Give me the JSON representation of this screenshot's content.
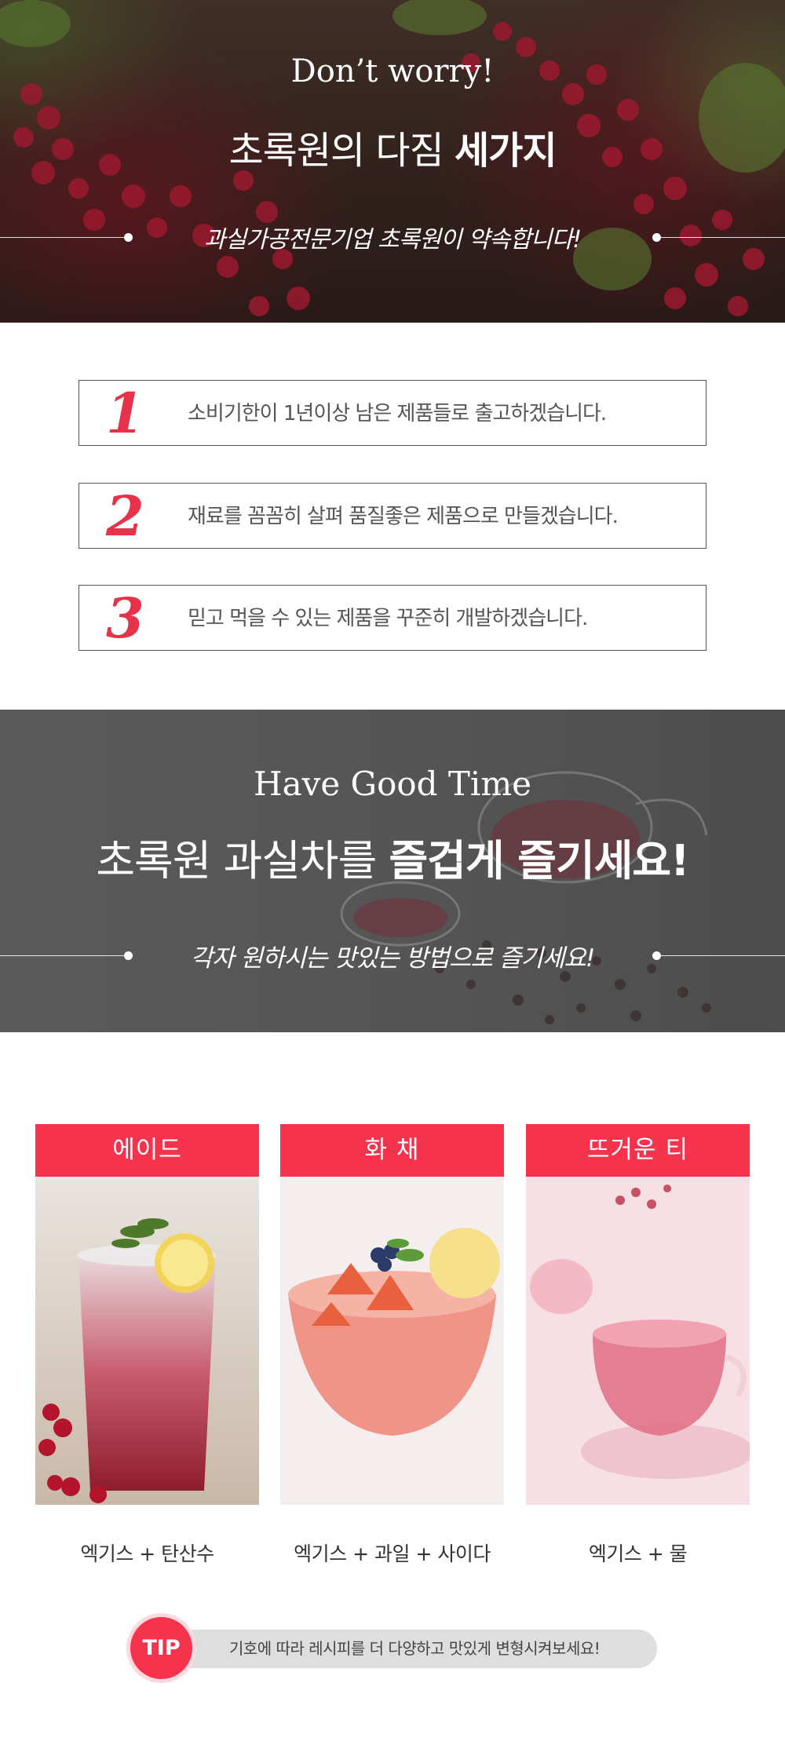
{
  "hero": {
    "title_en": "Don’t worry!",
    "title_ko_light": "초록원의 다짐 ",
    "title_ko_bold": "세가지",
    "subtitle": "과실가공전문기업 초록원이 약속합니다!"
  },
  "promises": [
    {
      "number": "1",
      "text": "소비기한이 1년이상 남은 제품들로 출고하겠습니다."
    },
    {
      "number": "2",
      "text": "재료를 꼼꼼히 살펴 품질좋은 제품으로 만들겠습니다."
    },
    {
      "number": "3",
      "text": "믿고 먹을 수 있는 제품을 꾸준히 개발하겠습니다."
    }
  ],
  "band": {
    "title_en": "Have Good Time",
    "title_ko_light": "초록원 과실차를 ",
    "title_ko_bold": "즐겁게 즐기세요!",
    "subtitle": "각자 원하시는 맛있는 방법으로 즐기세요!"
  },
  "recipes": [
    {
      "title": "에이드",
      "caption": "엑기스 + 탄산수"
    },
    {
      "title": "화 채",
      "caption": "엑기스 + 과일 + 사이다"
    },
    {
      "title": "뜨거운 티",
      "caption": "엑기스 + 물"
    }
  ],
  "tip": {
    "label": "TIP",
    "text": "기호에 따라 레시피를 더 다양하고 맛있게 변형시켜보세요!"
  },
  "colors": {
    "accent_red": "#f5334c",
    "number_red": "#e8324a",
    "band_gray": "#555555"
  }
}
